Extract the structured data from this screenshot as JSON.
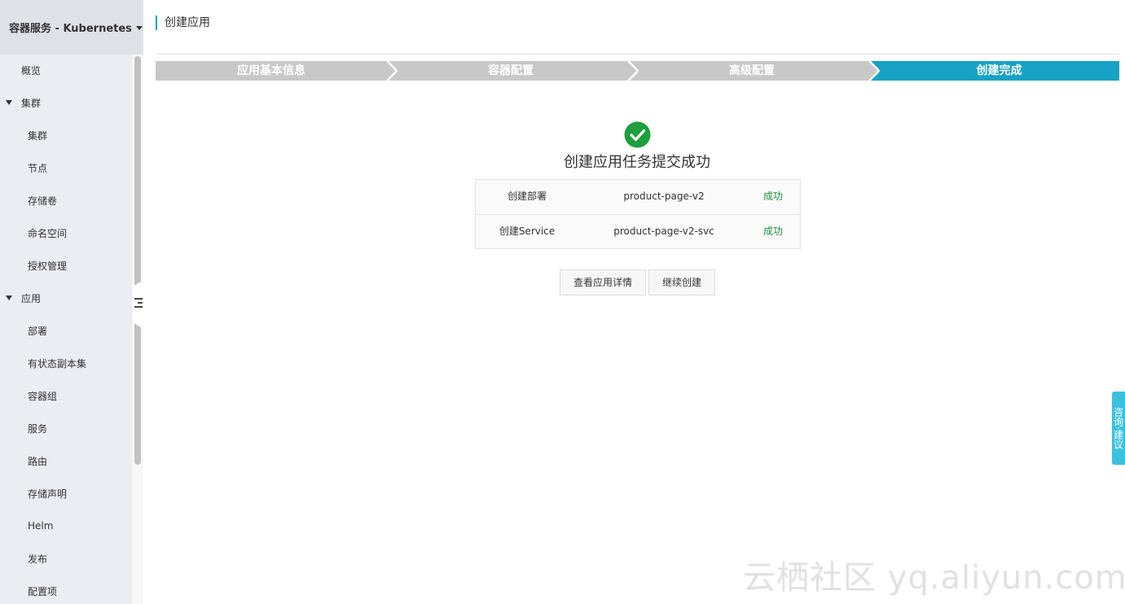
{
  "sidebar": {
    "product_title": "容器服务 - Kubernetes",
    "items": [
      {
        "label": "概览",
        "level": 0
      },
      {
        "label": "集群",
        "level": 0,
        "group": true
      },
      {
        "label": "集群",
        "level": 1
      },
      {
        "label": "节点",
        "level": 1
      },
      {
        "label": "存储卷",
        "level": 1
      },
      {
        "label": "命名空间",
        "level": 1
      },
      {
        "label": "授权管理",
        "level": 1
      },
      {
        "label": "应用",
        "level": 0,
        "group": true
      },
      {
        "label": "部署",
        "level": 1
      },
      {
        "label": "有状态副本集",
        "level": 1
      },
      {
        "label": "容器组",
        "level": 1
      },
      {
        "label": "服务",
        "level": 1
      },
      {
        "label": "路由",
        "level": 1
      },
      {
        "label": "存储声明",
        "level": 1
      },
      {
        "label": "Helm",
        "level": 1
      },
      {
        "label": "发布",
        "level": 1
      },
      {
        "label": "配置项",
        "level": 1
      }
    ]
  },
  "page": {
    "title": "创建应用"
  },
  "steps": [
    {
      "label": "应用基本信息",
      "active": false
    },
    {
      "label": "容器配置",
      "active": false
    },
    {
      "label": "高级配置",
      "active": false
    },
    {
      "label": "创建完成",
      "active": true
    }
  ],
  "result": {
    "title": "创建应用任务提交成功",
    "rows": [
      {
        "action": "创建部署",
        "name": "product-page-v2",
        "status": "成功"
      },
      {
        "action": "创建Service",
        "name": "product-page-v2-svc",
        "status": "成功"
      }
    ]
  },
  "buttons": {
    "view_detail": "查看应用详情",
    "continue_create": "继续创建"
  },
  "feedback": {
    "label": "咨询·建议"
  },
  "watermark": "云栖社区 yq.aliyun.com",
  "colors": {
    "step_inactive": "#c8c8c8",
    "step_active": "#17a2c6",
    "success_green": "#1e9e3c",
    "status_text": "#1e8e3e",
    "accent": "#00a2ca",
    "feedback_tab": "#3bc1de"
  },
  "icons": {
    "success": "check-circle-icon",
    "sidebar_toggle": "collapse-icon"
  }
}
